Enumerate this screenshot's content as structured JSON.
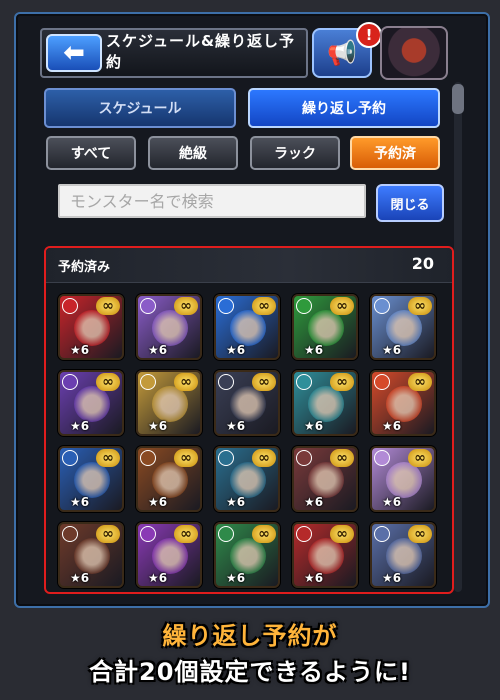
{
  "header": {
    "back_icon": "back-arrow-icon",
    "title": "スケジュール&繰り返し予約",
    "speaker_icon": "speaker-icon",
    "alert_badge": "!",
    "avatar_icon": "monster-avatar-icon"
  },
  "tabs": [
    {
      "label": "スケジュール",
      "active": false
    },
    {
      "label": "繰り返し予約",
      "active": true
    }
  ],
  "filters": [
    {
      "label": "すべて",
      "active": false
    },
    {
      "label": "絶級",
      "active": false
    },
    {
      "label": "ラック",
      "active": false
    },
    {
      "label": "予約済",
      "active": true
    }
  ],
  "search": {
    "placeholder": "モンスター名で検索",
    "value": "",
    "close_label": "閉じる"
  },
  "reserved": {
    "title": "予約済み",
    "count": "20",
    "monsters": [
      {
        "stars": "★6",
        "infinity": "∞",
        "color": "#c8242a"
      },
      {
        "stars": "★6",
        "infinity": "∞",
        "color": "#8a5cc8"
      },
      {
        "stars": "★6",
        "infinity": "∞",
        "color": "#2a6dd6"
      },
      {
        "stars": "★6",
        "infinity": "∞",
        "color": "#2f9a3c"
      },
      {
        "stars": "★6",
        "infinity": "∞",
        "color": "#6a8fd0"
      },
      {
        "stars": "★6",
        "infinity": "∞",
        "color": "#6b3fb0"
      },
      {
        "stars": "★6",
        "infinity": "∞",
        "color": "#c39a3a"
      },
      {
        "stars": "★6",
        "infinity": "∞",
        "color": "#3a3f55"
      },
      {
        "stars": "★6",
        "infinity": "∞",
        "color": "#2f8f9a"
      },
      {
        "stars": "★6",
        "infinity": "∞",
        "color": "#d64a2a"
      },
      {
        "stars": "★6",
        "infinity": "∞",
        "color": "#2a5fb5"
      },
      {
        "stars": "★6",
        "infinity": "∞",
        "color": "#8a4a22"
      },
      {
        "stars": "★6",
        "infinity": "∞",
        "color": "#2a6f8f"
      },
      {
        "stars": "★6",
        "infinity": "∞",
        "color": "#7a3a3a"
      },
      {
        "stars": "★6",
        "infinity": "∞",
        "color": "#b28ad6"
      },
      {
        "stars": "★6",
        "infinity": "∞",
        "color": "#6e3a2a"
      },
      {
        "stars": "★6",
        "infinity": "∞",
        "color": "#8a3ab5"
      },
      {
        "stars": "★6",
        "infinity": "∞",
        "color": "#2f8a4a"
      },
      {
        "stars": "★6",
        "infinity": "∞",
        "color": "#b52a2a"
      },
      {
        "stars": "★6",
        "infinity": "∞",
        "color": "#5a6fa8"
      }
    ]
  },
  "caption": {
    "line1": "繰り返し予約が",
    "line2": "合計20個設定できるように!"
  },
  "colors": {
    "accent_blue": "#2c78ff",
    "accent_orange": "#ff9a2a",
    "panel_border": "#e01d1d",
    "gold": "#ffe36a"
  }
}
